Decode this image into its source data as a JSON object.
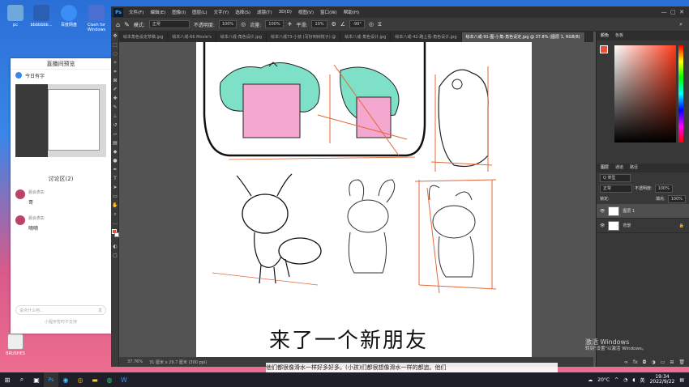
{
  "desktop": {
    "icons": [
      {
        "label": "pc",
        "color": "#6fa8dc"
      },
      {
        "label": "bbbbbbb...",
        "color": "#2b5fb3"
      },
      {
        "label": "百度网盘",
        "color": "#3a8ef5"
      },
      {
        "label": "Clash for Windows",
        "color": "#4a6fd0"
      }
    ],
    "brushes_label": "BRUSHES"
  },
  "live_panel": {
    "title": "直播间预览",
    "host_name": "今日有字",
    "discussion_title": "讨论区(2)",
    "comments": [
      {
        "user": "晨会表彰",
        "text": "哥"
      },
      {
        "user": "晨会表彰",
        "text": "嘀嘀"
      }
    ],
    "input_placeholder": "说点什么吧...",
    "send_label": "发",
    "footer": "小程序暂时不支持"
  },
  "ps": {
    "menu": [
      "文件(F)",
      "编辑(E)",
      "图像(I)",
      "图层(L)",
      "文字(Y)",
      "选择(S)",
      "滤镜(T)",
      "3D(D)",
      "视图(V)",
      "窗口(W)",
      "帮助(H)"
    ],
    "options": {
      "mode_label": "模式:",
      "mode_value": "正常",
      "opacity_label": "不透明度:",
      "opacity_value": "100%",
      "flow_label": "流量:",
      "flow_value": "100%",
      "smooth_label": "平滑:",
      "smooth_value": "10%",
      "angle_value": "-99°"
    },
    "tabs": [
      "绘本角色设定草稿.jpg",
      "绘本八戒-66 Movie's",
      "绘本八戒-角色设计.jpg",
      "绘本八戒73-小孩 (写好到树枝子) @",
      "绘本八戒-角色设计.jpg",
      "绘本八戒-42-路上看-角色设计.jpg",
      "绘本八戒-91-图-小角-角色设定.jpg @ 37.8% (图层 1, RGB/8)"
    ],
    "status_zoom": "37.76%",
    "status_doc": "31 厘米 x 29.7 厘米 (300 ppi)",
    "handwriting": "来了一个新朋友",
    "panels": {
      "color_tabs": [
        "颜色",
        "色板"
      ],
      "layers_tabs": [
        "图层",
        "通道",
        "路径"
      ],
      "filter_label": "Q 类型",
      "blend_mode": "正常",
      "opacity_label": "不透明度:",
      "opacity_value": "100%",
      "lock_label": "锁定:",
      "fill_label": "填充:",
      "fill_value": "100%",
      "layers": [
        "图层 1",
        "背景"
      ],
      "fg_color": "#e8503a",
      "hue_color": "#ff3a1a"
    }
  },
  "caption": "他们都很像滑水一样好多好多。(小孩)们都很想像滑水一样的都追。他们",
  "watermark": {
    "title": "激活 Windows",
    "subtitle": "转到\"设置\"以激活 Windows。"
  },
  "taskbar": {
    "temp": "20°C",
    "time": "19:34",
    "date": "2022/9/22",
    "ime": "英"
  }
}
